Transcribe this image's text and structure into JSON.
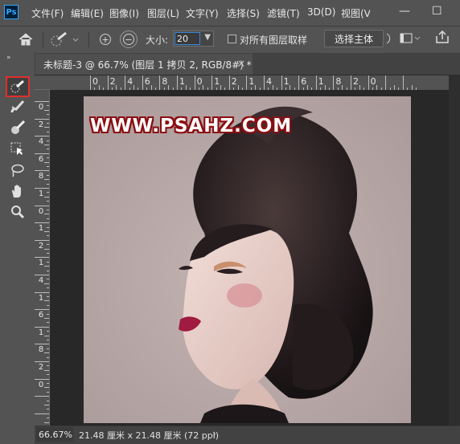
{
  "app": {
    "logo": "Ps"
  },
  "menu": [
    "文件(F)",
    "编辑(E)",
    "图像(I)",
    "图层(L)",
    "文字(Y)",
    "选择(S)",
    "滤镜(T)",
    "3D(D)",
    "视图(V"
  ],
  "window_controls": {
    "minimize": "—",
    "restore": "☐"
  },
  "options_bar": {
    "home_icon": "home-icon",
    "brush_preset_icon": "quick-selection-brush-icon",
    "add_mode": "+",
    "subtract_mode": "−",
    "size_label": "大小:",
    "size_value": "20",
    "sample_all_layers_label": "对所有图层取样",
    "select_subject_label": "选择主体"
  },
  "document_tab": {
    "title": "未标题-3 @ 66.7% (图层 1 拷贝 2, RGB/8#) *",
    "close": "×"
  },
  "toolbar": {
    "collapse": "»",
    "tools": [
      "quick-selection-icon",
      "brush-icon",
      "mixer-brush-icon",
      "object-selection-icon",
      "lasso-icon",
      "hand-icon",
      "zoom-icon"
    ]
  },
  "rulers": {
    "horizontal_labels": [
      "0",
      "2",
      "4",
      "6",
      "8",
      "1",
      "0",
      "1",
      "2",
      "1",
      "4",
      "1",
      "6",
      "1",
      "8",
      "2",
      "0"
    ],
    "vertical_labels": [
      "0",
      "2",
      "4",
      "6",
      "8",
      "1",
      "0",
      "1",
      "2",
      "1",
      "4",
      "1",
      "6",
      "1",
      "8",
      "2",
      "0"
    ]
  },
  "canvas": {
    "watermark": "WWW.PSAHZ.COM",
    "background_color": "#b8a9a8"
  },
  "status": {
    "zoom": "66.67%",
    "doc_info": "21.48 厘米 x 21.48 厘米 (72 ppi)",
    "arrow": "›"
  },
  "colors": {
    "accent": "#31a8ff",
    "highlight": "#e0302a",
    "panel": "#535353"
  }
}
